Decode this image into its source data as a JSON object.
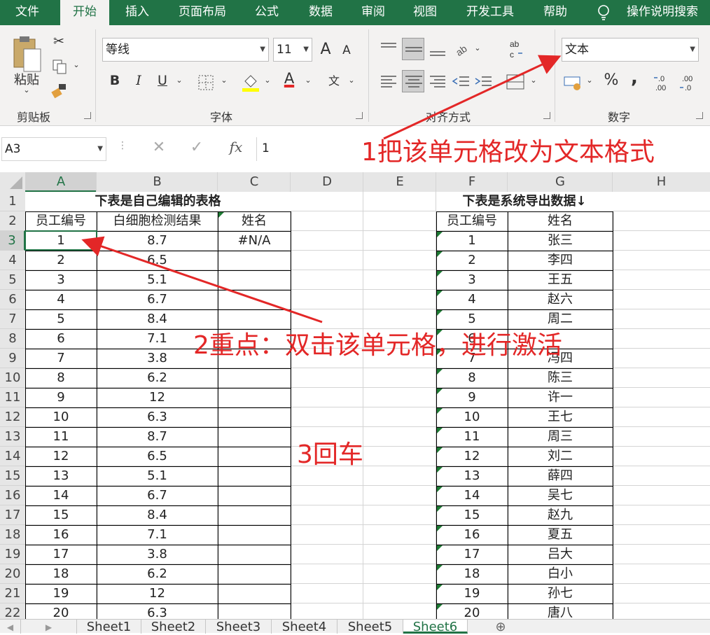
{
  "ribbon_tabs": [
    "文件",
    "开始",
    "插入",
    "页面布局",
    "公式",
    "数据",
    "审阅",
    "视图",
    "开发工具",
    "帮助",
    "操作说明搜索"
  ],
  "ribbon": {
    "paste_label": "粘贴",
    "font_name": "等线",
    "font_size": "11",
    "number_format": "文本",
    "groups": {
      "clipboard": "剪贴板",
      "font": "字体",
      "align": "对齐方式",
      "number": "数字"
    },
    "btn": {
      "bold": "B",
      "italic": "I",
      "underline": "U",
      "grow": "A",
      "shrink": "A",
      "percent": "%",
      "comma": ",",
      "inc_dec": ".00",
      "dec_dec": ".00",
      "wen": "文"
    }
  },
  "formula_bar": {
    "name_box": "A3",
    "fx": "fx",
    "value": "1"
  },
  "columns": [
    "A",
    "B",
    "C",
    "D",
    "E",
    "F",
    "G",
    "H"
  ],
  "rows": [
    "1",
    "2",
    "3",
    "4",
    "5",
    "6",
    "7",
    "8",
    "9",
    "10",
    "11",
    "12",
    "13",
    "14",
    "15",
    "16",
    "17",
    "18",
    "19",
    "20",
    "21",
    "22"
  ],
  "left_table": {
    "title": "下表是自己编辑的表格",
    "headers": [
      "员工编号",
      "白细胞检测结果",
      "姓名"
    ],
    "ids": [
      "1",
      "2",
      "3",
      "4",
      "5",
      "6",
      "7",
      "8",
      "9",
      "10",
      "11",
      "12",
      "13",
      "14",
      "15",
      "16",
      "17",
      "18",
      "19",
      "20"
    ],
    "results": [
      "8.7",
      "6.5",
      "5.1",
      "6.7",
      "8.4",
      "7.1",
      "3.8",
      "6.2",
      "12",
      "6.3",
      "8.7",
      "6.5",
      "5.1",
      "6.7",
      "8.4",
      "7.1",
      "3.8",
      "6.2",
      "12",
      "6.3"
    ],
    "name_value": "#N/A"
  },
  "right_table": {
    "title": "下表是系统导出数据↓",
    "headers": [
      "员工编号",
      "姓名"
    ],
    "ids": [
      "1",
      "2",
      "3",
      "4",
      "5",
      "6",
      "7",
      "8",
      "9",
      "10",
      "11",
      "12",
      "13",
      "14",
      "15",
      "16",
      "17",
      "18",
      "19",
      "20"
    ],
    "names": [
      "张三",
      "李四",
      "王五",
      "赵六",
      "周二",
      "",
      "冯四",
      "陈三",
      "许一",
      "王七",
      "周三",
      "刘二",
      "薛四",
      "吴七",
      "赵九",
      "夏五",
      "吕大",
      "白小",
      "孙七",
      "唐八"
    ]
  },
  "annotations": {
    "step1": "1把该单元格改为文本格式",
    "step2": "2重点：双击该单元格，进行激活",
    "step3": "3回车"
  },
  "sheet_tabs": [
    "Sheet1",
    "Sheet2",
    "Sheet3",
    "Sheet4",
    "Sheet5",
    "Sheet6"
  ],
  "colors": {
    "excel_green": "#217346",
    "annotation_red": "#e32727",
    "grid": "#d4d4d4"
  }
}
